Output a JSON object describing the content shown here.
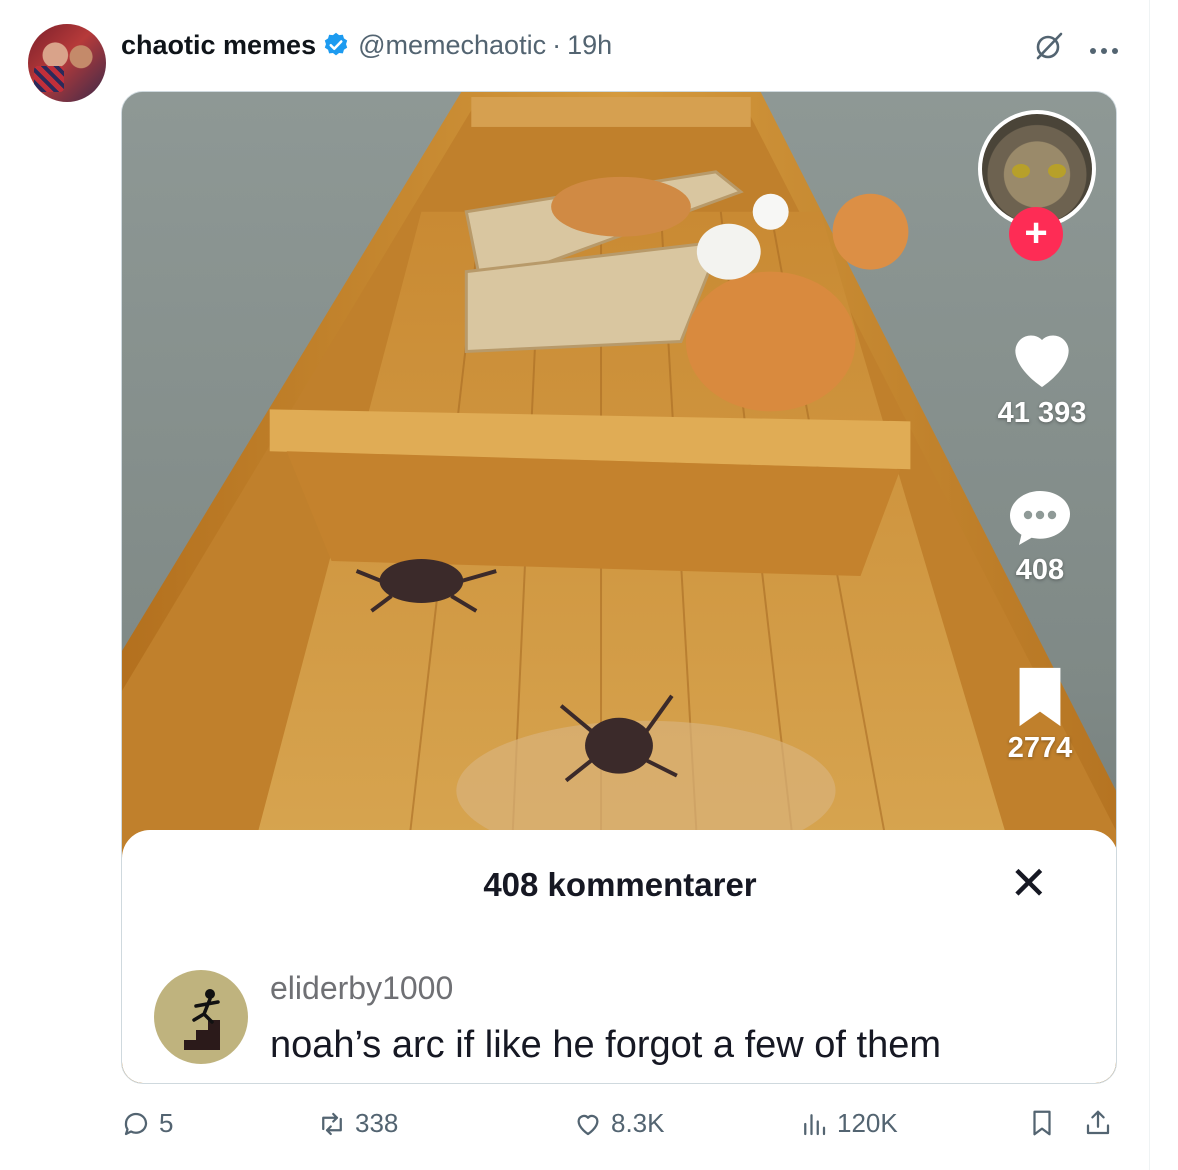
{
  "post": {
    "author_name": "chaotic memes",
    "author_handle": "@memechaotic",
    "separator": "·",
    "time": "19h"
  },
  "media": {
    "side_counts": {
      "likes": "41 393",
      "comments": "408",
      "saves": "2774"
    },
    "comments_panel": {
      "title": "408 kommentarer",
      "close_label": "✕",
      "comment_user": "eliderby1000",
      "comment_text": "noah’s arc if like he forgot a few of them"
    }
  },
  "actions": {
    "replies": "5",
    "reposts": "338",
    "likes": "8.3K",
    "views": "120K"
  },
  "colors": {
    "verified": "#1d9bf0",
    "tiktok_plus": "#fe2c55",
    "muted_text": "#536471",
    "boat_wood": "#c98a2e"
  },
  "icons": [
    "verified-badge-icon",
    "grok-icon",
    "more-icon",
    "heart-icon",
    "comment-bubble-icon",
    "bookmark-icon",
    "reply-icon",
    "repost-icon",
    "like-icon",
    "views-icon",
    "bookmark-icon",
    "share-icon"
  ]
}
